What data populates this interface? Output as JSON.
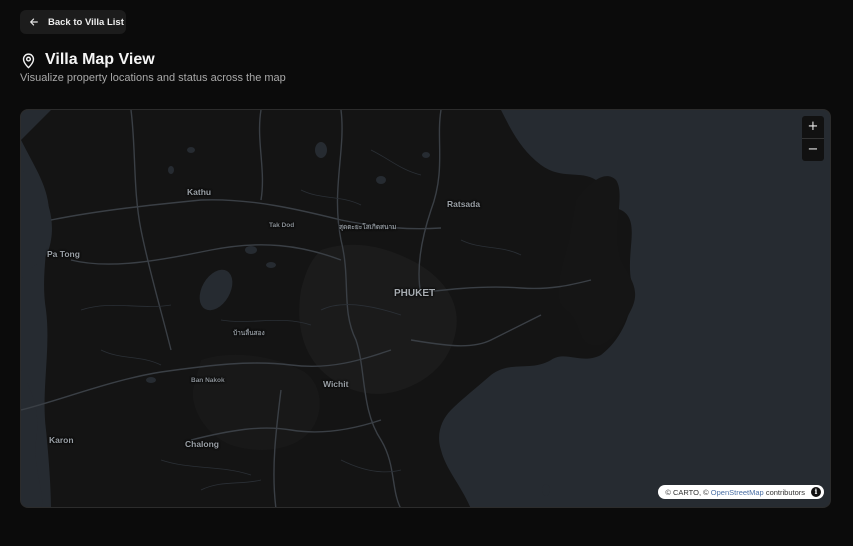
{
  "back_button": {
    "label": "Back to Villa List"
  },
  "header": {
    "title": "Villa Map View",
    "subtitle": "Visualize property locations and status across the map"
  },
  "map": {
    "zoom_in": "+",
    "zoom_out": "−",
    "labels": [
      {
        "id": "kathu",
        "text": "Kathu"
      },
      {
        "id": "patong",
        "text": "Pa Tong"
      },
      {
        "id": "ratsada",
        "text": "Ratsada"
      },
      {
        "id": "takdod",
        "text": "Tak Dod"
      },
      {
        "id": "thai1",
        "text": "สุดตะยะโสเกิดสนาม"
      },
      {
        "id": "phuket",
        "text": "PHUKET"
      },
      {
        "id": "thai2",
        "text": "บ้านลื่นสอง"
      },
      {
        "id": "bannakok",
        "text": "Ban Nakok"
      },
      {
        "id": "wichit",
        "text": "Wichit"
      },
      {
        "id": "karon",
        "text": "Karon"
      },
      {
        "id": "chalong",
        "text": "Chalong"
      }
    ],
    "attribution": {
      "prefix": "© CARTO, ©",
      "osm": "OpenStreetMap",
      "suffix": "contributors"
    }
  }
}
